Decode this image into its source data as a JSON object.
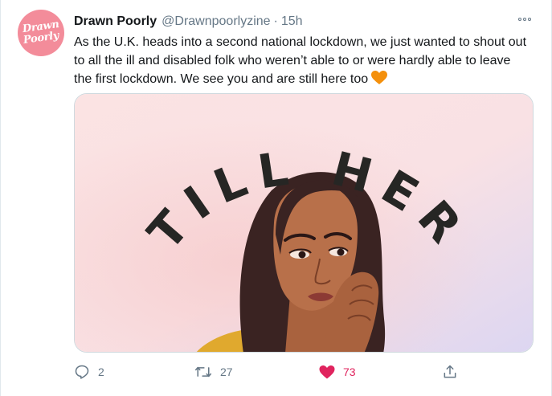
{
  "tweet": {
    "avatar_line1": "Drawn",
    "avatar_line2": "Poorly",
    "display_name": "Drawn Poorly",
    "handle": "@Drawnpoorlyzine",
    "separator": "·",
    "timestamp": "15h",
    "text": "As the U.K. heads into a second national lockdown, we just wanted to shout out to all the ill and disabled folk who weren’t able to or were hardly able to leave the first lockdown. We see you and are still here too",
    "emoji": "orange-heart",
    "image_text": "STILL HERE"
  },
  "actions": {
    "reply_count": "2",
    "retweet_count": "27",
    "like_count": "73"
  },
  "colors": {
    "like": "#e0245e",
    "muted": "#657786",
    "text": "#14171a",
    "avatar": "#f38c9a",
    "orange_heart": "#f4900c"
  },
  "icons": [
    "more-icon",
    "reply-icon",
    "retweet-icon",
    "like-icon",
    "share-icon"
  ]
}
